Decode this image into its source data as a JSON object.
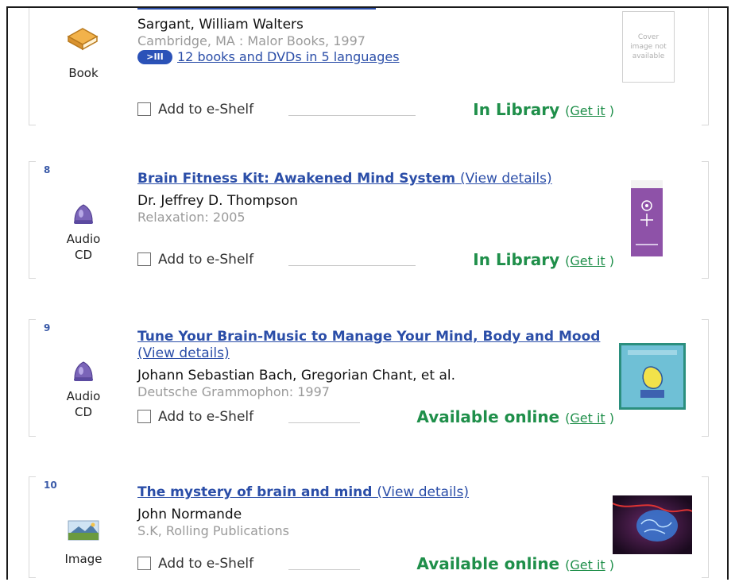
{
  "results": [
    {
      "number": "",
      "type": "Book",
      "title": "",
      "view_details": "",
      "author": "Sargant, William Walters",
      "publisher": "Cambridge, MA : Malor Books, 1997",
      "related_badge": ">III",
      "related": "12 books and DVDs in 5 languages",
      "shelf": "Add to e-Shelf",
      "status": "In Library",
      "get_it": "Get it",
      "cover_text": "Cover image not available"
    },
    {
      "number": "8",
      "type": "Audio CD",
      "title": "Brain Fitness Kit: Awakened Mind System",
      "view_details": "(View details)",
      "author": "Dr. Jeffrey D. Thompson",
      "publisher": "Relaxation: 2005",
      "shelf": "Add to e-Shelf",
      "status": "In Library",
      "get_it": "Get it"
    },
    {
      "number": "9",
      "type": "Audio CD",
      "title": "Tune Your Brain-Music to Manage Your Mind, Body and Mood",
      "view_details": "(View details)",
      "author": "Johann Sebastian Bach, Gregorian Chant, et al.",
      "publisher": "Deutsche Grammophon: 1997",
      "shelf": "Add to e-Shelf",
      "status": "Available online",
      "get_it": "Get it"
    },
    {
      "number": "10",
      "type": "Image",
      "title": "The mystery of brain and mind",
      "view_details": "(View details)",
      "author": "John Normande",
      "publisher": "S.K, Rolling Publications",
      "shelf": "Add to e-Shelf",
      "status": "Available online",
      "get_it": "Get it"
    }
  ],
  "icons": {
    "book": "book-icon",
    "audio": "audio-cd-icon",
    "image": "image-icon",
    "related": "related-editions-icon"
  },
  "colors": {
    "link": "#2b4ea8",
    "status_green": "#1f8f4a",
    "muted": "#9a9a9a"
  }
}
